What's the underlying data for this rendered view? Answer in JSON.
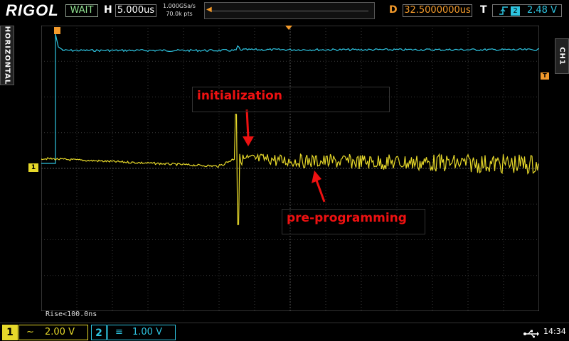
{
  "brand": "RIGOL",
  "status": "WAIT",
  "horizontal": {
    "label": "H",
    "timebase": "5.000us",
    "sample_rate": "1.000GSa/s",
    "points": "70.0k pts"
  },
  "delay": {
    "label": "D",
    "value": "32.5000000us"
  },
  "trigger": {
    "label": "T",
    "source": "2",
    "level": "2.48 V",
    "edge_icon": "rising-edge-icon"
  },
  "side_tabs": {
    "left": "HORIZONTAL",
    "right": "CH1"
  },
  "annotations": {
    "init": "initialization",
    "pre": "pre-programming"
  },
  "measurement": "Rise<100.0ns",
  "channels": [
    {
      "num": "1",
      "coupling": "~",
      "scale": "2.00 V",
      "color": "#e6d82a"
    },
    {
      "num": "2",
      "coupling": "≡",
      "scale": "1.00 V",
      "color": "#2ec4e0"
    }
  ],
  "clock": "14:34",
  "colors": {
    "ch1": "#e6d82a",
    "ch2": "#2ec4e0",
    "trigger": "#f39a2b",
    "annotation": "#ee1111"
  }
}
